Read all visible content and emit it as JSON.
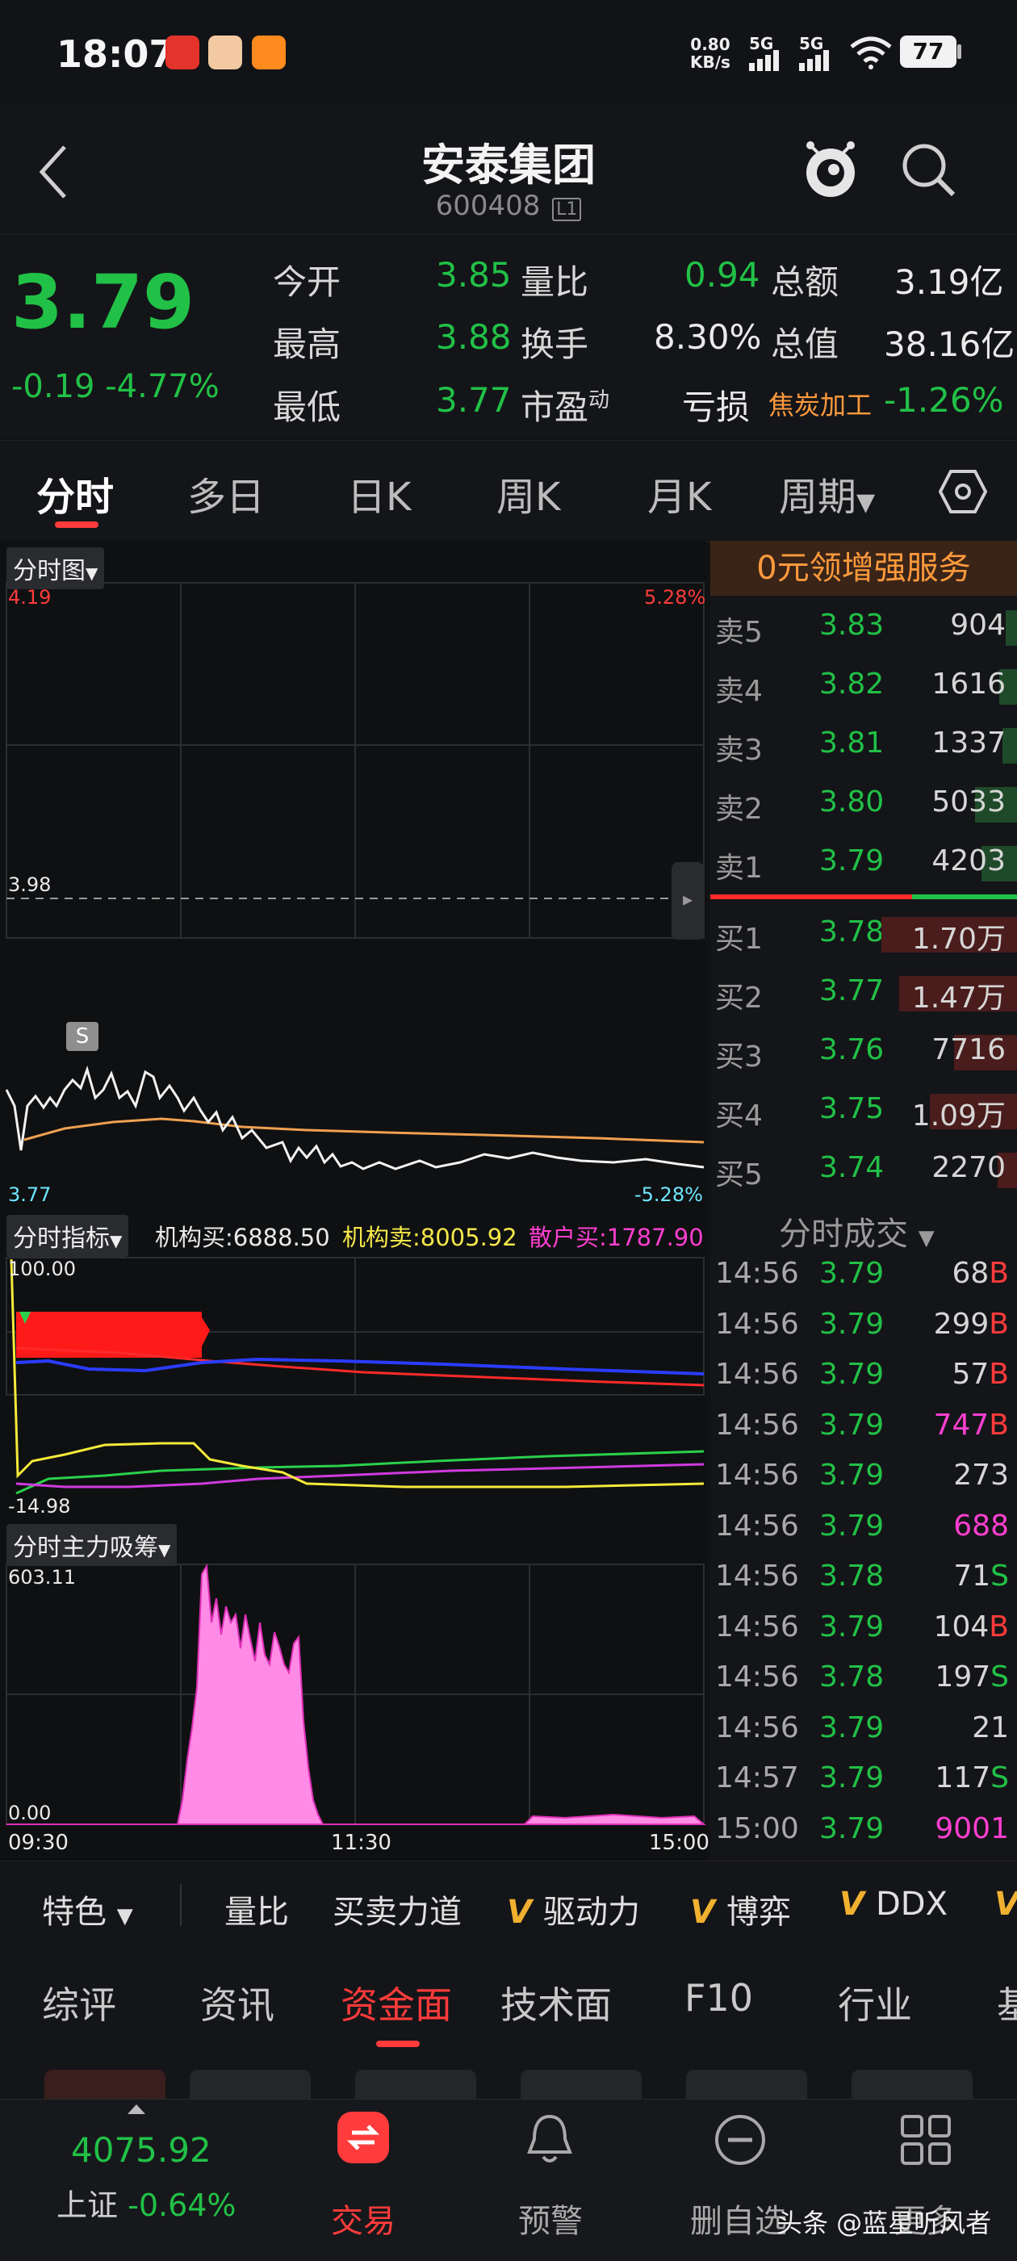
{
  "status_bar": {
    "time": "18:07",
    "net_speed": "0.80",
    "net_unit": "KB/s",
    "sig1": "5G",
    "sig2": "5G",
    "battery": "77"
  },
  "header": {
    "title": "安泰集团",
    "code": "600408",
    "code_badge": "L1"
  },
  "quote": {
    "price": "3.79",
    "change": "-0.19",
    "change_pct": "-4.77%",
    "fields": [
      {
        "label": "今开",
        "value": "3.85"
      },
      {
        "label": "最高",
        "value": "3.88"
      },
      {
        "label": "最低",
        "value": "3.77"
      },
      {
        "label": "量比",
        "value": "0.94"
      },
      {
        "label": "换手",
        "value": "8.30%"
      },
      {
        "label": "市盈",
        "label_sup": "动",
        "value": "亏损"
      },
      {
        "label": "总额",
        "value": "3.19亿"
      },
      {
        "label": "总值",
        "value": "38.16亿"
      }
    ],
    "industry": "焦炭加工",
    "industry_pct": "-1.26%"
  },
  "tabs": [
    "分时",
    "多日",
    "日K",
    "周K",
    "月K",
    "周期"
  ],
  "chart": {
    "main_label": "分时图",
    "price_high": "4.19",
    "pct_high": "5.28%",
    "price_mid": "3.98",
    "price_low": "3.77",
    "pct_low": "-5.28%",
    "marker": "S",
    "ind_label": "分时指标",
    "ind_buy_label": "机构买:6888.50",
    "ind_sell_label": "机构卖:8005.92",
    "ind_retail_label": "散户买:1787.90",
    "ind_top": "100.00",
    "ind_bottom": "-14.98",
    "flow_label": "分时主力吸筹",
    "flow_top": "603.11",
    "flow_bottom": "0.00",
    "t_start": "09:30",
    "t_mid": "11:30",
    "t_end": "15:00"
  },
  "book": {
    "promo": "0元领增强服务",
    "asks": [
      {
        "name": "卖5",
        "price": "3.83",
        "vol": "904"
      },
      {
        "name": "卖4",
        "price": "3.82",
        "vol": "1616"
      },
      {
        "name": "卖3",
        "price": "3.81",
        "vol": "1337"
      },
      {
        "name": "卖2",
        "price": "3.80",
        "vol": "5033"
      },
      {
        "name": "卖1",
        "price": "3.79",
        "vol": "4203"
      }
    ],
    "bids": [
      {
        "name": "买1",
        "price": "3.78",
        "vol": "1.70万"
      },
      {
        "name": "买2",
        "price": "3.77",
        "vol": "1.47万"
      },
      {
        "name": "买3",
        "price": "3.76",
        "vol": "7716"
      },
      {
        "name": "买4",
        "price": "3.75",
        "vol": "1.09万"
      },
      {
        "name": "买5",
        "price": "3.74",
        "vol": "2270"
      }
    ],
    "trades_label": "分时成交",
    "trades": [
      {
        "time": "14:56",
        "price": "3.79",
        "vol": "68",
        "side": "B",
        "color": "#d6d6d6"
      },
      {
        "time": "14:56",
        "price": "3.79",
        "vol": "299",
        "side": "B",
        "color": "#d6d6d6"
      },
      {
        "time": "14:56",
        "price": "3.79",
        "vol": "57",
        "side": "B",
        "color": "#d6d6d6"
      },
      {
        "time": "14:56",
        "price": "3.79",
        "vol": "747",
        "side": "B",
        "color": "#ff3fd1"
      },
      {
        "time": "14:56",
        "price": "3.79",
        "vol": "273",
        "side": "",
        "color": "#d6d6d6"
      },
      {
        "time": "14:56",
        "price": "3.79",
        "vol": "688",
        "side": "",
        "color": "#ff3fd1"
      },
      {
        "time": "14:56",
        "price": "3.78",
        "vol": "71",
        "side": "S",
        "color": "#d6d6d6"
      },
      {
        "time": "14:56",
        "price": "3.79",
        "vol": "104",
        "side": "B",
        "color": "#d6d6d6"
      },
      {
        "time": "14:56",
        "price": "3.78",
        "vol": "197",
        "side": "S",
        "color": "#d6d6d6"
      },
      {
        "time": "14:56",
        "price": "3.79",
        "vol": "21",
        "side": "",
        "color": "#d6d6d6"
      },
      {
        "time": "14:57",
        "price": "3.79",
        "vol": "117",
        "side": "S",
        "color": "#d6d6d6"
      },
      {
        "time": "15:00",
        "price": "3.79",
        "vol": "9001",
        "side": "",
        "color": "#ff3fd1"
      }
    ]
  },
  "indicators": {
    "special": "特色",
    "items": [
      "量比",
      "买卖力道",
      "驱动力",
      "博弈",
      "DDX"
    ],
    "v_mark": "V"
  },
  "subtabs": [
    "综评",
    "资讯",
    "资金面",
    "技术面",
    "F10",
    "行业",
    "基"
  ],
  "bottom_nav": {
    "index_value": "4075.92",
    "index_name": "上证",
    "index_pct": "-0.64%",
    "items": [
      "交易",
      "预警",
      "删自选",
      "更多"
    ],
    "watermark": "头条 @蓝星听风者"
  }
}
